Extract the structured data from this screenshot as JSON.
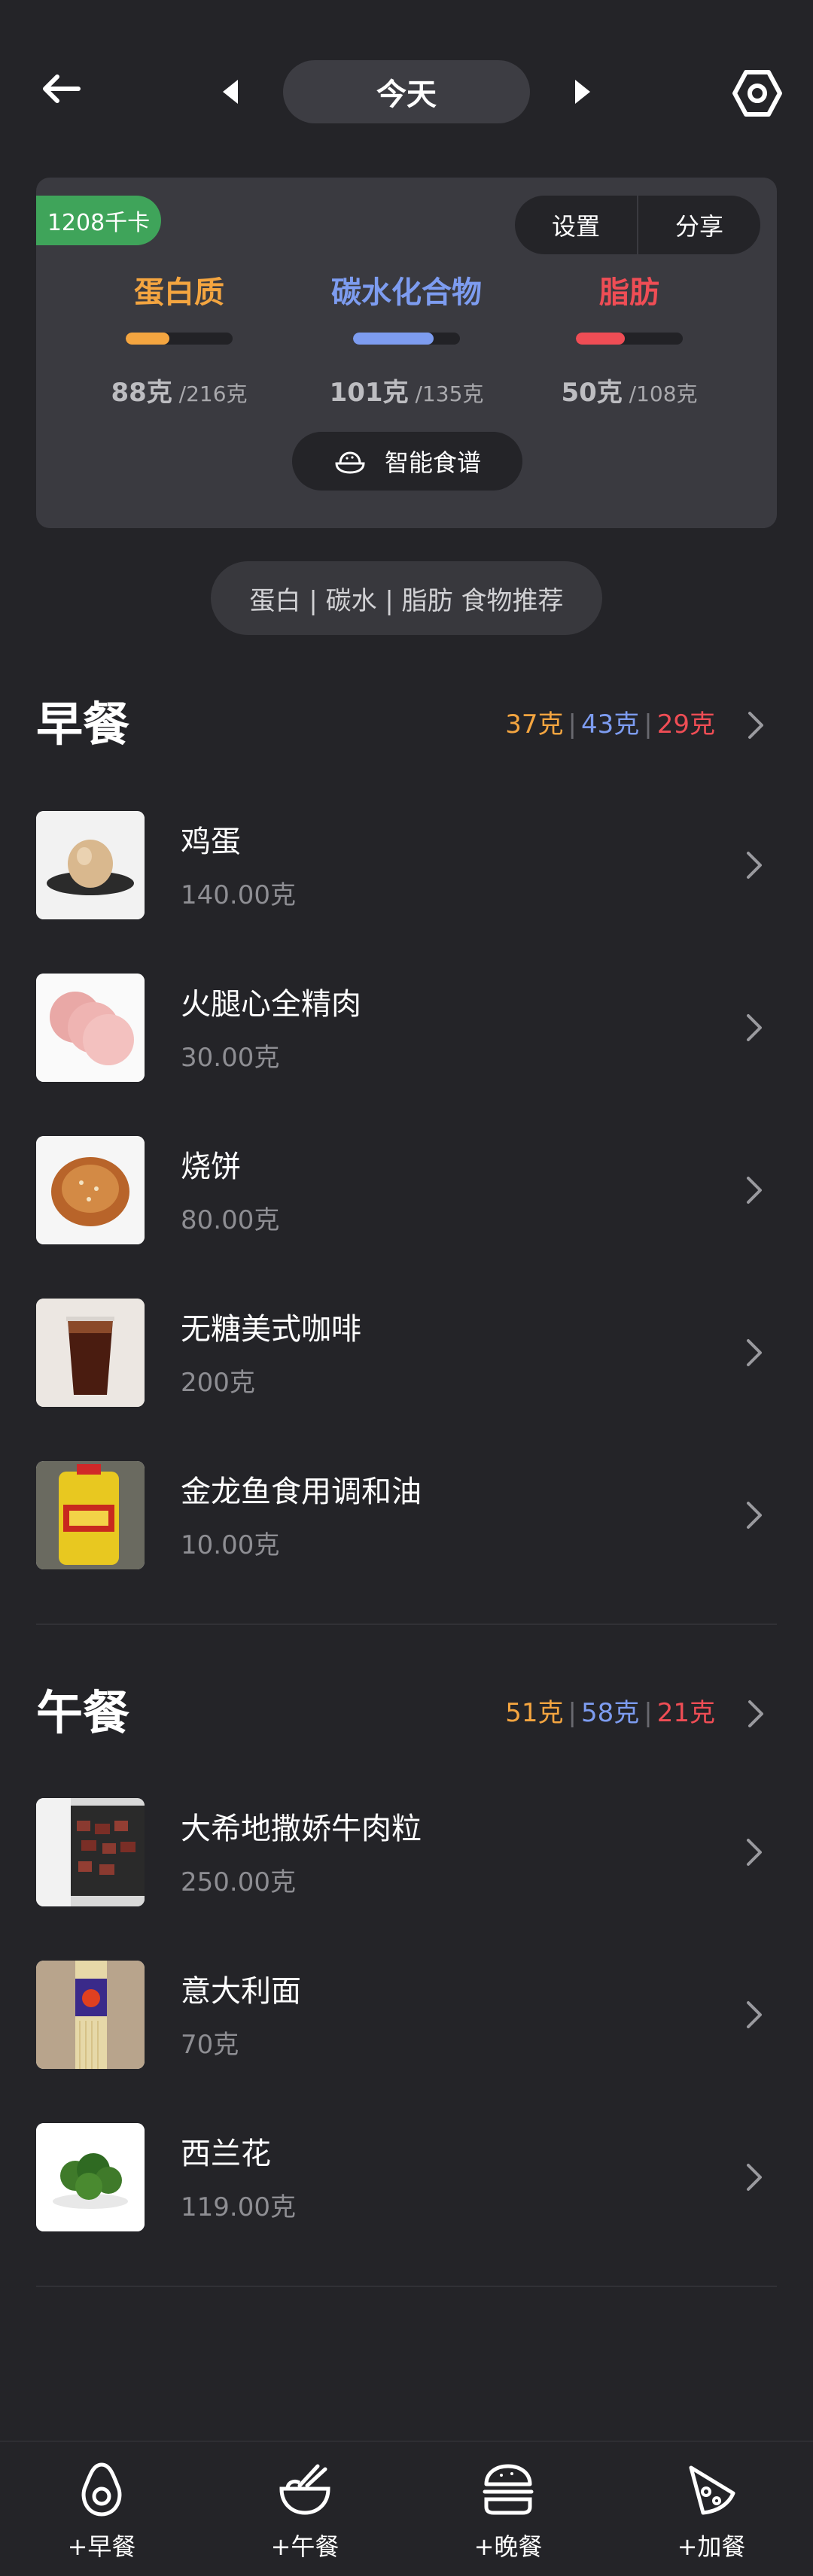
{
  "header": {
    "date_label": "今天",
    "back_icon": "back-arrow-icon",
    "prev_icon": "triangle-left-icon",
    "next_icon": "triangle-right-icon",
    "settings_icon": "hex-settings-icon"
  },
  "summary": {
    "kcal": "1208千卡",
    "settings_label": "设置",
    "share_label": "分享",
    "macros": [
      {
        "name": "蛋白质",
        "amount": "88克",
        "target": "/216克",
        "fraction": 0.41,
        "color": "#f4a540"
      },
      {
        "name": "碳水化合物",
        "amount": "101克",
        "target": "/135克",
        "fraction": 0.75,
        "color": "#7d9cf0"
      },
      {
        "name": "脂肪",
        "amount": "50克",
        "target": "/108克",
        "fraction": 0.46,
        "color": "#ef4d55"
      }
    ],
    "recipe_label": "智能食谱"
  },
  "recommend_label": "蛋白 | 碳水 | 脂肪 食物推荐",
  "colors": {
    "protein": "#f4a540",
    "carb": "#7d9cf0",
    "fat": "#ef4d55",
    "kcal_badge": "#3fa45a"
  },
  "meals": [
    {
      "title": "早餐",
      "protein": "37克",
      "carb": "43克",
      "fat": "29克",
      "items": [
        {
          "name": "鸡蛋",
          "qty": "140.00克"
        },
        {
          "name": "火腿心全精肉",
          "qty": "30.00克"
        },
        {
          "name": "烧饼",
          "qty": "80.00克"
        },
        {
          "name": "无糖美式咖啡",
          "qty": "200克"
        },
        {
          "name": "金龙鱼食用调和油",
          "qty": "10.00克"
        }
      ]
    },
    {
      "title": "午餐",
      "protein": "51克",
      "carb": "58克",
      "fat": "21克",
      "items": [
        {
          "name": "大希地撒娇牛肉粒",
          "qty": "250.00克"
        },
        {
          "name": "意大利面",
          "qty": "70克"
        },
        {
          "name": "西兰花",
          "qty": "119.00克"
        }
      ]
    }
  ],
  "bottom_nav": [
    {
      "label": "+早餐",
      "icon": "avocado-icon"
    },
    {
      "label": "+午餐",
      "icon": "noodle-bowl-icon"
    },
    {
      "label": "+晚餐",
      "icon": "burger-icon"
    },
    {
      "label": "+加餐",
      "icon": "pizza-slice-icon"
    }
  ]
}
